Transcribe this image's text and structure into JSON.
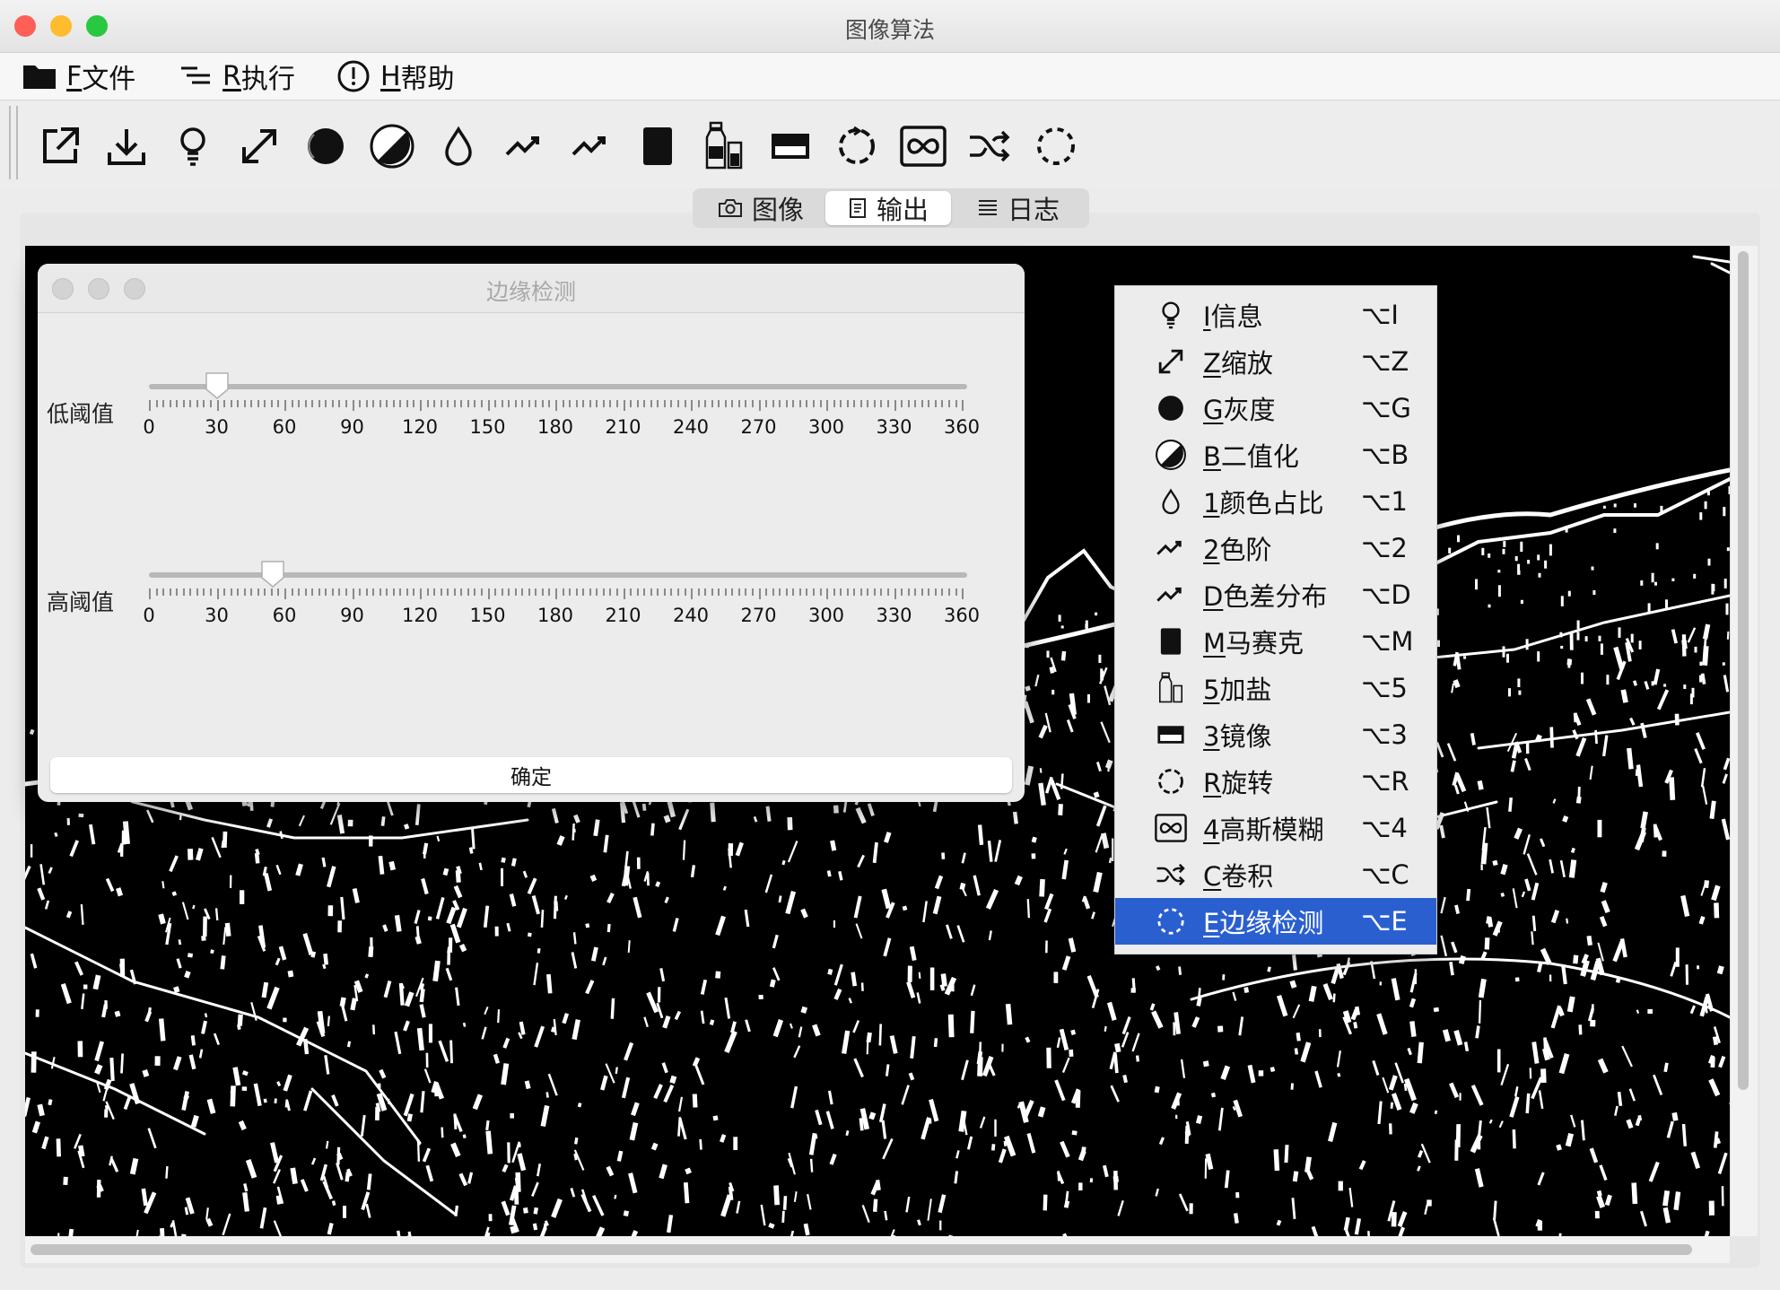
{
  "window": {
    "title": "图像算法",
    "traffic": {
      "close": "#fe5f57",
      "minimize": "#febc2e",
      "zoom": "#28c840"
    }
  },
  "menubar": [
    {
      "mnemonic": "F",
      "label": "文件",
      "icon": "folder-icon"
    },
    {
      "mnemonic": "R",
      "label": "执行",
      "icon": "list-run-icon"
    },
    {
      "mnemonic": "H",
      "label": "帮助",
      "icon": "info-circle-icon"
    }
  ],
  "toolbar": [
    "export-icon",
    "download-icon",
    "bulb-icon",
    "resize-icon",
    "grayscale-icon",
    "binarize-icon",
    "drop-icon",
    "trend-icon",
    "trend-icon",
    "mosaic-icon",
    "salt-icon",
    "mirror-icon",
    "rotate-icon",
    "blur-icon",
    "shuffle-icon",
    "dashed-circle-icon"
  ],
  "tabs": [
    {
      "label": "图像",
      "icon": "camera-icon",
      "selected": false
    },
    {
      "label": "输出",
      "icon": "document-icon",
      "selected": true
    },
    {
      "label": "日志",
      "icon": "lines-icon",
      "selected": false
    }
  ],
  "dialog": {
    "title": "边缘检测",
    "sliders": [
      {
        "label": "低阈值",
        "value": 30,
        "min": 0,
        "max": 360
      },
      {
        "label": "高阈值",
        "value": 55,
        "min": 0,
        "max": 360
      }
    ],
    "ticks": [
      "0",
      "30",
      "60",
      "90",
      "120",
      "150",
      "180",
      "210",
      "240",
      "270",
      "300",
      "330",
      "360"
    ],
    "ok_label": "确定"
  },
  "context_menu": [
    {
      "mnemonic": "I",
      "label": "信息",
      "shortcut": "⌥I",
      "icon": "bulb-icon"
    },
    {
      "mnemonic": "Z",
      "label": "缩放",
      "shortcut": "⌥Z",
      "icon": "resize-icon"
    },
    {
      "mnemonic": "G",
      "label": "灰度",
      "shortcut": "⌥G",
      "icon": "grayscale-icon"
    },
    {
      "mnemonic": "B",
      "label": "二值化",
      "shortcut": "⌥B",
      "icon": "binarize-icon"
    },
    {
      "mnemonic": "1",
      "label": "颜色占比",
      "shortcut": "⌥1",
      "icon": "drop-icon"
    },
    {
      "mnemonic": "2",
      "label": "色阶",
      "shortcut": "⌥2",
      "icon": "trend-icon"
    },
    {
      "mnemonic": "D",
      "label": "色差分布",
      "shortcut": "⌥D",
      "icon": "trend-icon"
    },
    {
      "mnemonic": "M",
      "label": "马赛克",
      "shortcut": "⌥M",
      "icon": "mosaic-icon"
    },
    {
      "mnemonic": "5",
      "label": "加盐",
      "shortcut": "⌥5",
      "icon": "salt-icon"
    },
    {
      "mnemonic": "3",
      "label": "镜像",
      "shortcut": "⌥3",
      "icon": "mirror-icon"
    },
    {
      "mnemonic": "R",
      "label": "旋转",
      "shortcut": "⌥R",
      "icon": "rotate-icon"
    },
    {
      "mnemonic": "4",
      "label": "高斯模糊",
      "shortcut": "⌥4",
      "icon": "blur-icon"
    },
    {
      "mnemonic": "C",
      "label": "卷积",
      "shortcut": "⌥C",
      "icon": "shuffle-icon"
    },
    {
      "mnemonic": "E",
      "label": "边缘检测",
      "shortcut": "⌥E",
      "icon": "dashed-circle-icon",
      "selected": true
    }
  ]
}
